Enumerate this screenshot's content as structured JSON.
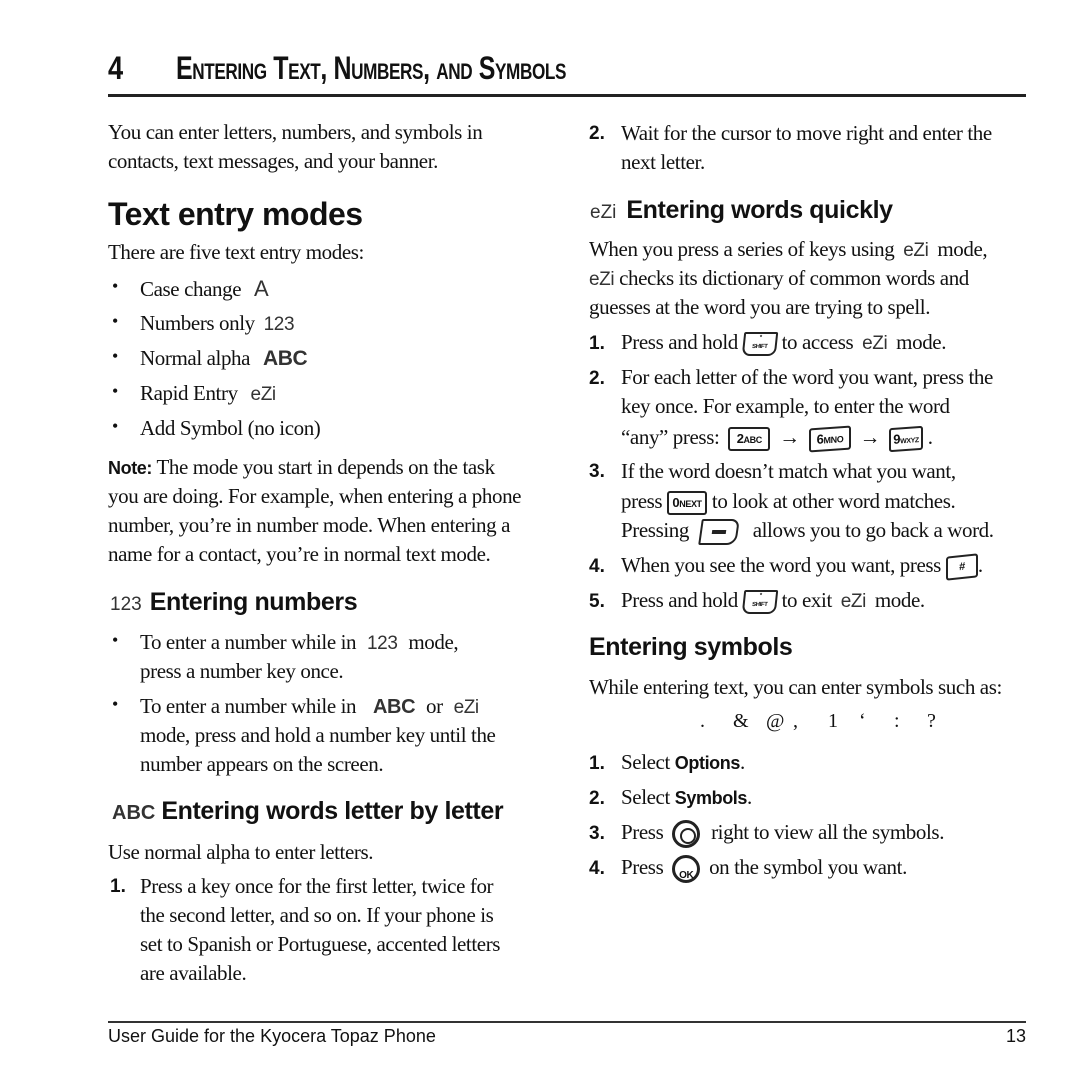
{
  "chapter": {
    "number": "4",
    "title": "Entering Text, Numbers, and Symbols"
  },
  "left": {
    "intro": [
      "You can enter letters, numbers, and symbols in",
      "contacts, text messages, and your banner."
    ],
    "modes_heading": "Text entry modes",
    "modes_intro": "There are five text entry modes:",
    "modes": [
      {
        "label": "Case change",
        "icon": "A"
      },
      {
        "label": "Numbers only",
        "icon": "123"
      },
      {
        "label": "Normal alpha",
        "icon": "ABC"
      },
      {
        "label": "Rapid Entry",
        "icon": "eZi"
      },
      {
        "label": "Add Symbol (no icon)",
        "icon": ""
      }
    ],
    "note_label": "Note:",
    "note_lines": [
      "The mode you start in depends on the task",
      "you are doing. For example, when entering a phone",
      "number, you’re in number mode. When entering a",
      "name for a contact, you’re in normal text mode."
    ],
    "numbers_icon": "123",
    "numbers_heading": "Entering numbers",
    "numbers_bullets": [
      {
        "line1_pre": "To enter a number while in",
        "icon": "123",
        "line1_post": "mode,",
        "line2": "press a number key once."
      },
      {
        "line1_pre": "To enter a number while in",
        "icon": "ABC",
        "mid": "or",
        "icon2": "eZi",
        "line2": "mode, press and hold a number key until the",
        "line3": "number appears on the screen."
      }
    ],
    "letter_icon": "ABC",
    "letter_heading": "Entering words letter by letter",
    "letter_intro": "Use normal alpha to enter letters.",
    "letter_step1": {
      "num": "1.",
      "lines": [
        "Press a key once for the first letter, twice for",
        "the second letter, and so on. If your phone is",
        "set to Spanish or Portuguese, accented letters",
        "are available."
      ]
    }
  },
  "right": {
    "step2": {
      "num": "2.",
      "lines": [
        "Wait for the cursor to move right and enter the",
        "next letter."
      ]
    },
    "quick_icon": "eZi",
    "quick_heading": "Entering words quickly",
    "quick_intro": {
      "l1_pre": "When you press a series of keys using",
      "l1_icon": "eZi",
      "l1_post": "mode,",
      "l2_icon": "eZi",
      "l2_post": "checks its dictionary of common words and",
      "l3": "guesses at the word you are trying to spell."
    },
    "quick_steps": [
      {
        "num": "1.",
        "pre": "Press and hold",
        "key": "*SHIFT",
        "post": "to access",
        "icon": "eZi",
        "post2": "mode."
      },
      {
        "num": "2.",
        "lines": [
          "For each letter of the word you want, press the",
          "key once. For example, to enter the word"
        ],
        "l3_pre": "“any” press:",
        "keys": [
          {
            "big": "2",
            "small": "ABC"
          },
          {
            "big": "6",
            "small": "MNO"
          },
          {
            "big": "9",
            "small": "WXYZ"
          }
        ],
        "arrow": "→",
        "end": "."
      },
      {
        "num": "3.",
        "l1": "If the word doesn’t match what you want,",
        "l2_pre": "press",
        "l2_key": {
          "big": "0",
          "small": "NEXT"
        },
        "l2_post": "to look at other word matches.",
        "l3_pre": "Pressing",
        "l3_post": "allows you to go back a word."
      },
      {
        "num": "4.",
        "pre": "When you see the word you want, press",
        "key": "#",
        "post": "."
      },
      {
        "num": "5.",
        "pre": "Press and hold",
        "key": "*SHIFT",
        "post": "to exit",
        "icon": "eZi",
        "post2": "mode."
      }
    ],
    "symbols_heading": "Entering symbols",
    "symbols_intro": "While entering text, you can enter symbols such as:",
    "symbols_examples": [
      ".",
      "&",
      "@",
      ",",
      "1",
      "‘",
      ":",
      "?"
    ],
    "symbol_steps": [
      {
        "num": "1.",
        "pre": "Select",
        "bold": "Options",
        "post": "."
      },
      {
        "num": "2.",
        "pre": "Select",
        "bold": "Symbols",
        "post": "."
      },
      {
        "num": "3.",
        "pre": "Press",
        "post": "right to view all the symbols."
      },
      {
        "num": "4.",
        "pre": "Press",
        "key": "OK",
        "post": "on the symbol you want."
      }
    ]
  },
  "footer": {
    "title": "User Guide for the Kyocera Topaz Phone",
    "page": "13"
  }
}
